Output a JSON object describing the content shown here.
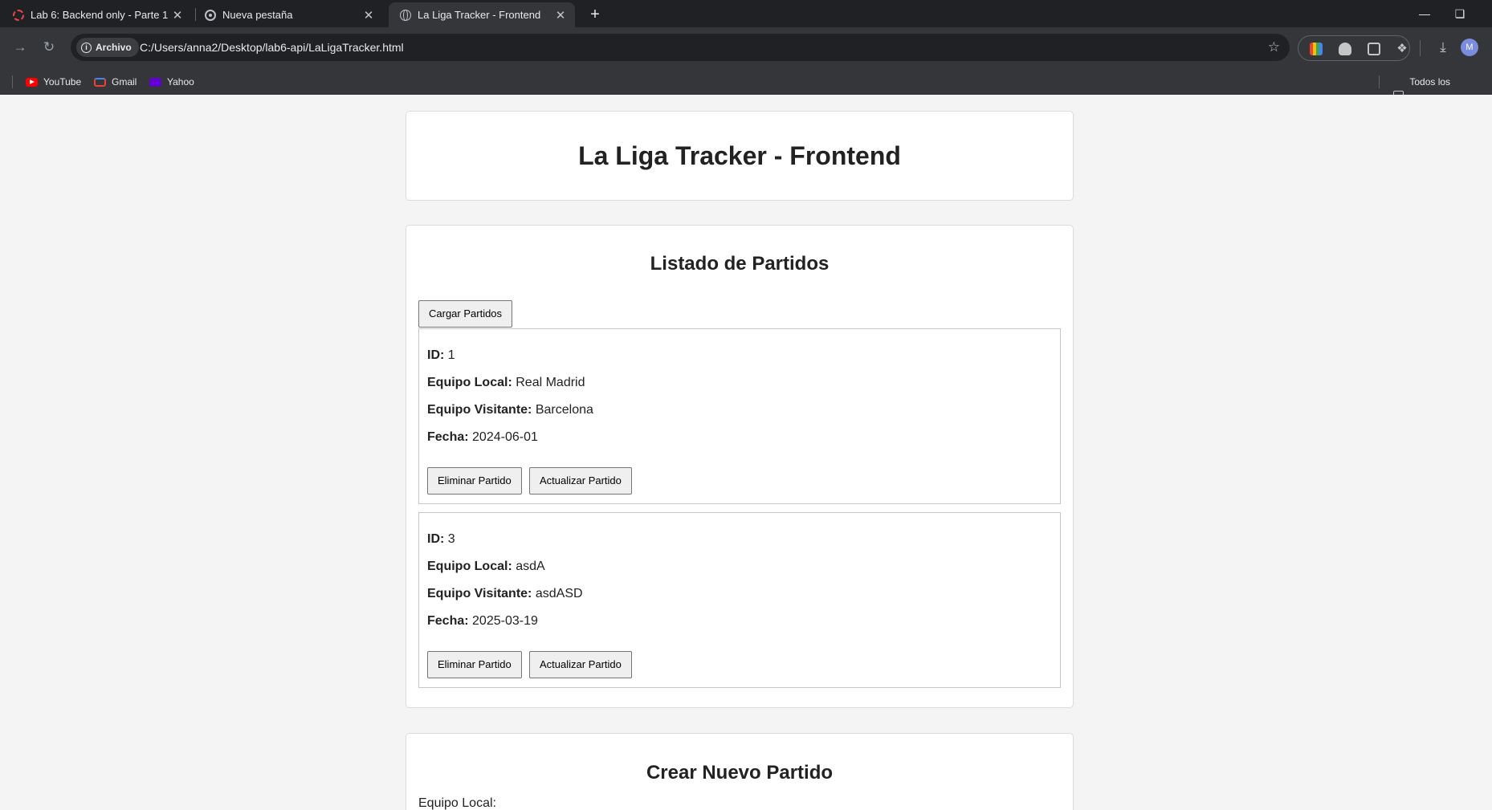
{
  "browser": {
    "tabs": [
      {
        "title": "Lab 6: Backend only - Parte 1",
        "active": false,
        "icon": "red-dashed-circle-icon"
      },
      {
        "title": "Nueva pestaña",
        "active": false,
        "icon": "chrome-icon"
      },
      {
        "title": "La Liga Tracker - Frontend",
        "active": true,
        "icon": "globe-icon"
      }
    ],
    "close_glyph": "✕",
    "new_tab_glyph": "+",
    "address": {
      "chip_label": "Archivo",
      "url": "C:/Users/anna2/Desktop/lab6-api/LaLigaTracker.html"
    },
    "profile_initial": "M",
    "bookmarks": [
      {
        "label": "YouTube",
        "icon": "youtube-icon"
      },
      {
        "label": "Gmail",
        "icon": "gmail-icon"
      },
      {
        "label": "Yahoo",
        "icon": "yahoo-icon"
      }
    ],
    "all_bookmarks_label": "Todos los marcadores"
  },
  "page": {
    "title": "La Liga Tracker - Frontend",
    "list_section": {
      "heading": "Listado de Partidos",
      "load_button": "Cargar Partidos",
      "field_labels": {
        "id": "ID:",
        "home": "Equipo Local:",
        "away": "Equipo Visitante:",
        "date": "Fecha:"
      },
      "delete_button": "Eliminar Partido",
      "update_button": "Actualizar Partido",
      "matches": [
        {
          "id": "1",
          "home": "Real Madrid",
          "away": "Barcelona",
          "date": "2024-06-01"
        },
        {
          "id": "3",
          "home": "asdA",
          "away": "asdASD",
          "date": "2025-03-19"
        }
      ]
    },
    "create_section": {
      "heading": "Crear Nuevo Partido",
      "home_label": "Equipo Local:"
    }
  }
}
